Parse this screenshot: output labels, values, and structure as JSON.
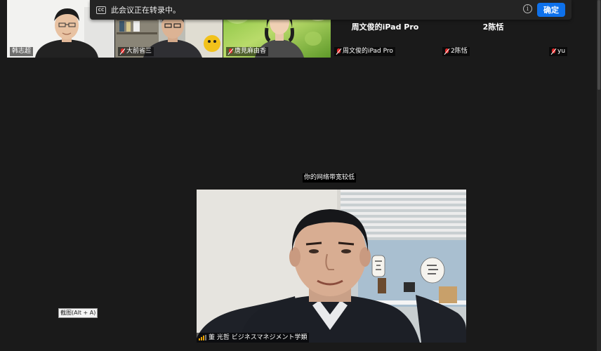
{
  "recording_banner": {
    "cc_icon_text": "CC",
    "message": "此会议正在转录中。",
    "info_icon_text": "i",
    "confirm_label": "确定"
  },
  "gallery": {
    "tiles": [
      {
        "name": "韩志超",
        "type": "video",
        "muted": false
      },
      {
        "name": "大前省三",
        "type": "video",
        "muted": true
      },
      {
        "name": "唐見麻由香",
        "type": "video",
        "muted": true
      },
      {
        "name": "周文俊的iPad Pro",
        "type": "text",
        "display_name": "周文俊的iPad Pro",
        "muted": true
      },
      {
        "name": "2陈恬",
        "type": "text",
        "display_name": "2陈恬",
        "muted": true
      },
      {
        "name": "yu",
        "type": "text",
        "display_name": "",
        "muted": true
      }
    ]
  },
  "main_view": {
    "bandwidth_notice": "你的网络带宽较低",
    "speaker_name": "董 光哲 ビジネスマネジメント学類"
  },
  "tooltip": {
    "text": "截图(Alt + A)"
  },
  "colors": {
    "background": "#1a1a1a",
    "banner": "#242424",
    "accent_blue": "#0e71eb",
    "muted_red": "#e02828",
    "signal_orange": "#e8a000"
  }
}
